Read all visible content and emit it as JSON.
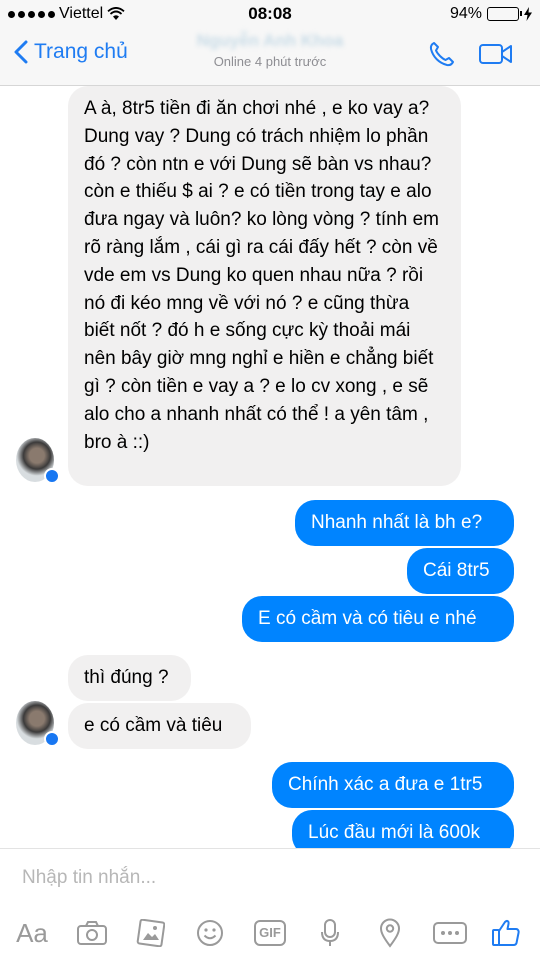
{
  "status_bar": {
    "carrier": "Viettel",
    "time": "08:08",
    "battery_percent": "94%",
    "battery_level": 0.94
  },
  "header": {
    "back_label": "Trang chủ",
    "contact_name": "Nguyễn Anh Khoa",
    "contact_status": "Online 4 phút trước"
  },
  "messages": [
    {
      "side": "in",
      "text": "A à, 8tr5 tiền đi ăn chơi nhé , e ko vay a? Dung vay ? Dung có trách nhiệm lo phần đó ? còn ntn e với Dung sẽ bàn vs nhau? còn e thiếu $ ai ? e có tiền trong tay e alo đưa ngay và luôn? ko lòng vòng ? tính em rõ ràng lắm , cái gì ra cái đấy hết ? còn về vde em vs Dung ko quen nhau nữa ? rồi nó đi kéo mng về với nó ? e cũng thừa biết nốt ? đó h e sống cực kỳ thoải mái nên bây giờ mng nghỉ e hiền e chẳng biết gì ? còn tiền e vay a ? e lo cv xong , e sẽ alo cho a nhanh nhất có thể ! a yên tâm , bro à ::)"
    },
    {
      "side": "out",
      "text": "Nhanh nhất là bh e?"
    },
    {
      "side": "out",
      "text": "Cái 8tr5"
    },
    {
      "side": "out",
      "text": "E có cầm và có tiêu e nhé"
    },
    {
      "side": "in",
      "text": "thì đúng ?"
    },
    {
      "side": "in",
      "text": "e có cầm và tiêu"
    },
    {
      "side": "out",
      "text": "Chính xác a đưa e 1tr5"
    },
    {
      "side": "out",
      "text": "Lúc đầu mới là 600k"
    }
  ],
  "composer": {
    "placeholder": "Nhập tin nhắn...",
    "text_button": "Aa",
    "gif_label": "GIF",
    "icons": [
      "camera-icon",
      "photo-icon",
      "emoji-icon",
      "gif-icon",
      "microphone-icon",
      "location-icon",
      "more-icon",
      "like-icon"
    ]
  },
  "colors": {
    "accent": "#1f7cf2",
    "outgoing_bubble": "#0084ff",
    "incoming_bubble": "#f1f0f0"
  }
}
